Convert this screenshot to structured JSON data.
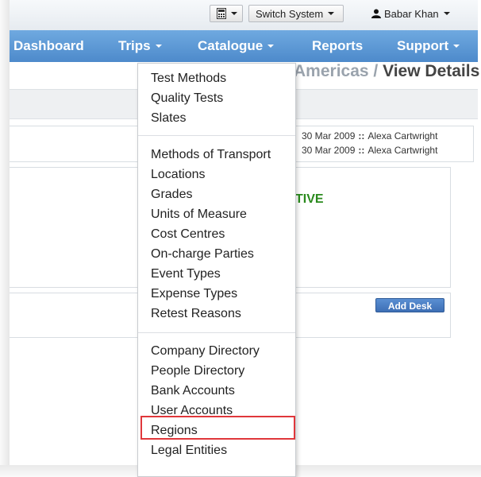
{
  "topbar": {
    "switch_system": "Switch System",
    "user_name": "Babar Khan"
  },
  "nav": {
    "items": [
      "Dashboard",
      "Trips",
      "Catalogue",
      "Reports",
      "Support"
    ]
  },
  "breadcrumb": {
    "segment": "Americas",
    "separator": "/",
    "current": "View Details"
  },
  "audit": {
    "rows": [
      {
        "date": "30 Mar 2009",
        "sep": "::",
        "user": "Alexa Cartwright"
      },
      {
        "date": "30 Mar 2009",
        "sep": "::",
        "user": "Alexa Cartwright"
      }
    ]
  },
  "status": {
    "text": "TIVE",
    "color": "#2a8a1d"
  },
  "actions": {
    "add_desk": "Add Desk"
  },
  "menu": {
    "group1": [
      "Test Methods",
      "Quality Tests",
      "Slates"
    ],
    "group2": [
      "Methods of Transport",
      "Locations",
      "Grades",
      "Units of Measure",
      "Cost Centres",
      "On-charge Parties",
      "Event Types",
      "Expense Types",
      "Retest Reasons"
    ],
    "group3": [
      "Company Directory",
      "People Directory",
      "Bank Accounts",
      "User Accounts",
      "Regions",
      "Legal Entities"
    ],
    "highlighted": "Regions",
    "highlight_color": "#e0373b"
  },
  "colors": {
    "nav_bg": "#4d8acb",
    "button_blue": "#3e6fb5"
  },
  "icons": {
    "calculator": "calculator-icon",
    "user": "user-icon"
  }
}
